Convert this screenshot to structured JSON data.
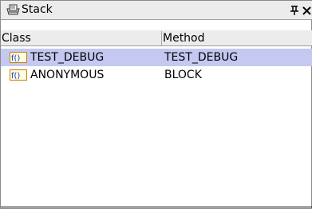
{
  "window": {
    "title": "Stack",
    "pin_glyph": "⊥",
    "close_glyph": "✕"
  },
  "table": {
    "columns": [
      "Class",
      "Method"
    ],
    "rows": [
      {
        "class": "TEST_DEBUG",
        "method": "TEST_DEBUG",
        "selected": true
      },
      {
        "class": "ANONYMOUS",
        "method": "BLOCK",
        "selected": false
      }
    ]
  },
  "icons": {
    "title": "stack-icon",
    "row": "function-icon"
  },
  "colors": {
    "selected_row": "#c5c8f1",
    "icon_border": "#c38400",
    "icon_text": "#1a3fbf"
  }
}
